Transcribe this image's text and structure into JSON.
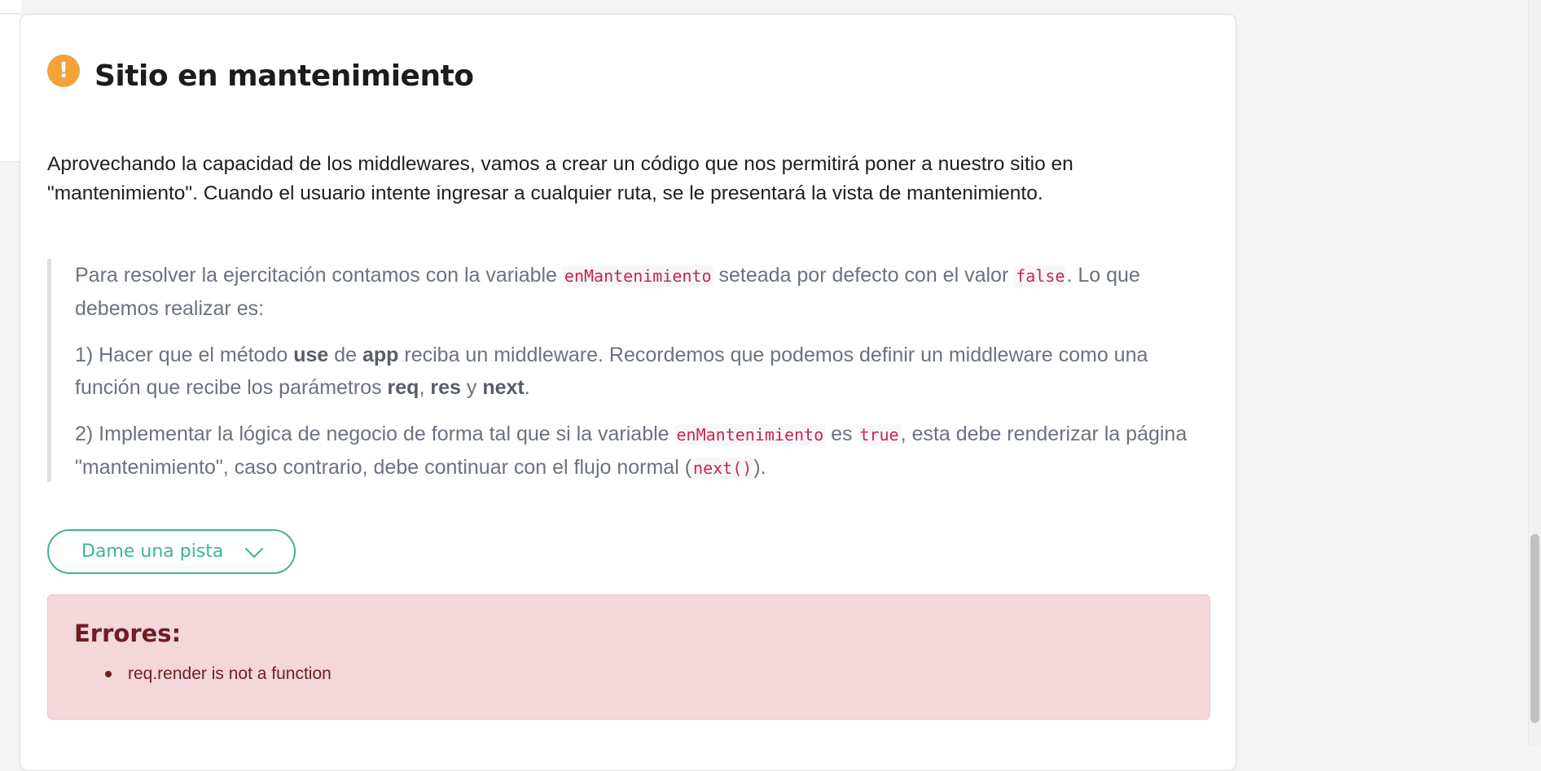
{
  "exercise": {
    "title": "Sitio en mantenimiento",
    "intro": "Aprovechando la capacidad de los middlewares, vamos a crear un código que nos permitirá poner a nuestro sitio en \"mantenimiento\". Cuando el usuario intente ingresar a cualquier ruta, se le presentará la vista de mantenimiento.",
    "quote": {
      "p1": {
        "t1": "Para resolver la ejercitación contamos con la variable ",
        "code1": "enMantenimiento",
        "t2": " seteada por defecto con el valor ",
        "code2": "false",
        "t3": ". Lo que debemos realizar es:"
      },
      "p2": {
        "t1": "1) Hacer que el método ",
        "b1": "use",
        "t2": " de ",
        "b2": "app",
        "t3": " reciba un middleware. Recordemos que podemos definir un middleware como una función que recibe los parámetros ",
        "b3": "req",
        "t4": ", ",
        "b4": "res",
        "t5": " y ",
        "b5": "next",
        "t6": "."
      },
      "p3": {
        "t1": "2) Implementar la lógica de negocio de forma tal que si la variable ",
        "code1": "enMantenimiento",
        "t2": " es ",
        "code2": "true",
        "t3": ", esta debe renderizar la página \"mantenimiento\", caso contrario, debe continuar con el flujo normal (",
        "code3": "next()",
        "t4": ")."
      }
    },
    "hint_button": "Dame una pista",
    "errors": {
      "heading": "Errores:",
      "items": [
        "req.render is not a function"
      ]
    }
  },
  "colors": {
    "warning_icon": "#f0a43a",
    "accent": "#3fb39b",
    "error_bg": "#f3d7da",
    "error_text": "#6f1d24",
    "code_text": "#c7254e"
  },
  "icons": {
    "warning": "exclamation-circle-icon",
    "hint": "chevron-down-icon"
  }
}
